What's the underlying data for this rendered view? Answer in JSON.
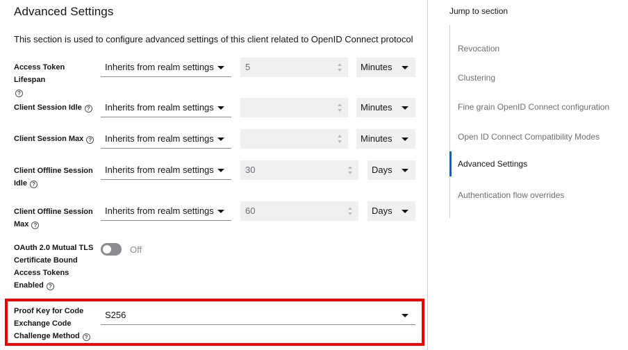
{
  "main": {
    "title": "Advanced Settings",
    "description": "This section is used to configure advanced settings of this client related to OpenID Connect protocol"
  },
  "help_glyph": "?",
  "fields": {
    "access_token_lifespan": {
      "label": "Access Token Lifespan",
      "select": "Inherits from realm settings",
      "number": "5",
      "unit": "Minutes"
    },
    "client_session_idle": {
      "label": "Client Session Idle",
      "select": "Inherits from realm settings",
      "number": "",
      "unit": "Minutes"
    },
    "client_session_max": {
      "label": "Client Session Max",
      "select": "Inherits from realm settings",
      "number": "",
      "unit": "Minutes"
    },
    "client_offline_session_idle": {
      "label_line1": "Client Offline Session",
      "label_line2": "Idle",
      "select": "Inherits from realm settings",
      "number": "30",
      "unit": "Days"
    },
    "client_offline_session_max": {
      "label_line1": "Client Offline Session",
      "label_line2": "Max",
      "select": "Inherits from realm settings",
      "number": "60",
      "unit": "Days"
    },
    "oauth_mtls": {
      "label_lines": [
        "OAuth 2.0 Mutual TLS",
        "Certificate Bound",
        "Access Tokens",
        "Enabled"
      ],
      "toggle_state": "Off"
    },
    "pkce": {
      "label_lines": [
        "Proof Key for Code",
        "Exchange Code",
        "Challenge Method"
      ],
      "select": "S256"
    }
  },
  "side": {
    "jump_label": "Jump to section",
    "items": [
      {
        "label": "Revocation"
      },
      {
        "label": "Clustering"
      },
      {
        "label": "Fine grain OpenID Connect configuration"
      },
      {
        "label": "Open ID Connect Compatibility Modes"
      },
      {
        "label": "Advanced Settings",
        "active": true
      },
      {
        "label": "Authentication flow overrides"
      }
    ]
  },
  "colors": {
    "accent": "#0066cc",
    "highlight": "#ee0000",
    "toggle_off": "#8a8d90"
  }
}
